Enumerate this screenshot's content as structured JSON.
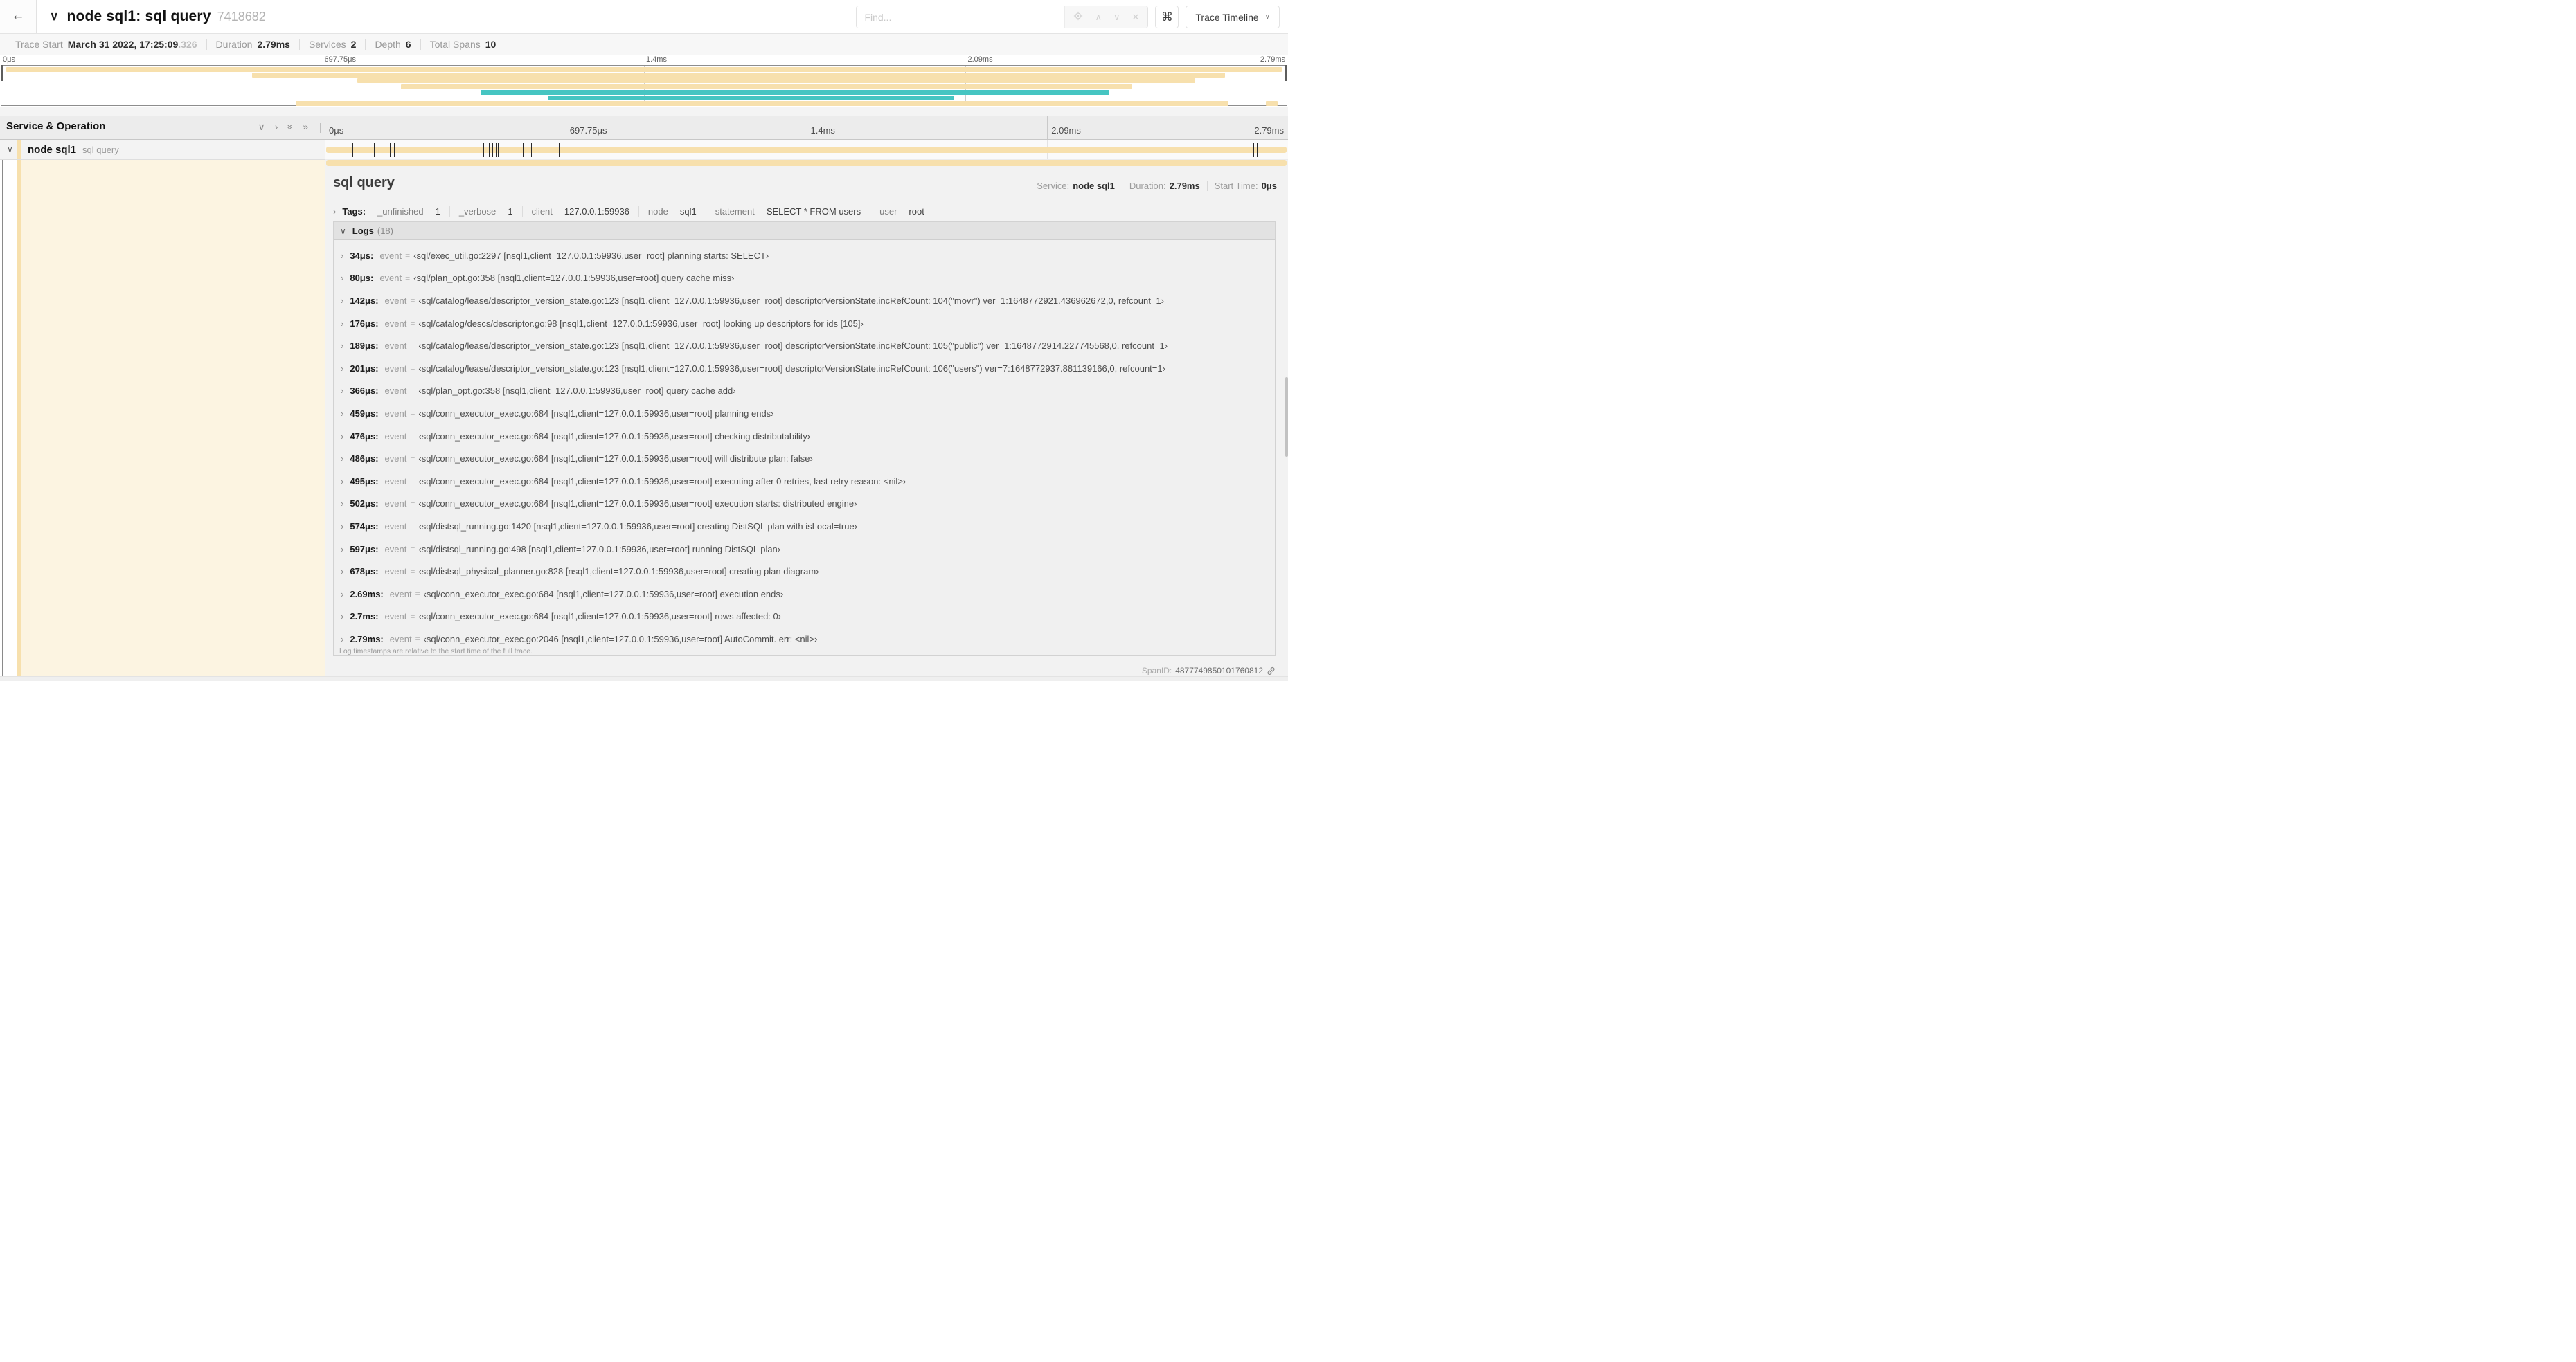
{
  "icons": {
    "back": "←",
    "chevron_down": "∨",
    "chevron_right": "›",
    "double_chevron": "»",
    "up": "∧",
    "close": "✕",
    "command": "⌘"
  },
  "header": {
    "title": "node sql1: sql query",
    "trace_id": "7418682",
    "find_placeholder": "Find...",
    "trace_timeline_label": "Trace Timeline"
  },
  "stats": {
    "items": [
      {
        "label": "Trace Start",
        "value": "March 31 2022, 17:25:09",
        "suffix": ".326"
      },
      {
        "label": "Duration",
        "value": "2.79ms",
        "suffix": ""
      },
      {
        "label": "Services",
        "value": "2",
        "suffix": ""
      },
      {
        "label": "Depth",
        "value": "6",
        "suffix": ""
      },
      {
        "label": "Total Spans",
        "value": "10",
        "suffix": ""
      }
    ]
  },
  "timeline": {
    "header_label": "Service & Operation",
    "ticks": [
      "0μs",
      "697.75μs",
      "1.4ms",
      "2.09ms",
      "2.79ms"
    ],
    "tick_positions": [
      0,
      0.25,
      0.5,
      0.75,
      1
    ],
    "grid_positions": [
      0,
      0.25,
      0.5,
      0.75
    ]
  },
  "minimap": {
    "bars": [
      {
        "row": 0,
        "start": 0.004,
        "end": 0.996,
        "color": "tan"
      },
      {
        "row": 1,
        "start": 0.195,
        "end": 0.952,
        "color": "tan"
      },
      {
        "row": 2,
        "start": 0.277,
        "end": 0.929,
        "color": "tan"
      },
      {
        "row": 3,
        "start": 0.311,
        "end": 0.88,
        "color": "tan"
      },
      {
        "row": 4,
        "start": 0.373,
        "end": 0.862,
        "color": "teal"
      },
      {
        "row": 5,
        "start": 0.425,
        "end": 0.741,
        "color": "teal"
      },
      {
        "row": 6,
        "start": 0.229,
        "end": 0.955,
        "color": "tan"
      },
      {
        "row": 6,
        "start": 0.984,
        "end": 0.993,
        "color": "tan"
      }
    ]
  },
  "span_row": {
    "service": "node sql1",
    "operation": "sql query",
    "log_marks_us": [
      34,
      80,
      142,
      176,
      189,
      201,
      366,
      459,
      476,
      486,
      495,
      502,
      574,
      597,
      678,
      2690,
      2700
    ],
    "trace_duration_us": 2790
  },
  "detail": {
    "title": "sql query",
    "meta": [
      {
        "label": "Service:",
        "value": "node sql1"
      },
      {
        "label": "Duration:",
        "value": "2.79ms"
      },
      {
        "label": "Start Time:",
        "value": "0μs"
      }
    ],
    "tags_label": "Tags:",
    "tags": [
      {
        "key": "_unfinished",
        "value": "1"
      },
      {
        "key": "_verbose",
        "value": "1"
      },
      {
        "key": "client",
        "value": "127.0.0.1:59936"
      },
      {
        "key": "node",
        "value": "sql1"
      },
      {
        "key": "statement",
        "value": "SELECT * FROM users"
      },
      {
        "key": "user",
        "value": "root"
      }
    ],
    "logs_label": "Logs",
    "logs_count": "(18)",
    "event_label": "event",
    "eq": "=",
    "logs": [
      {
        "time": "34μs:",
        "value": "‹sql/exec_util.go:2297 [nsql1,client=127.0.0.1:59936,user=root] planning starts: SELECT›"
      },
      {
        "time": "80μs:",
        "value": "‹sql/plan_opt.go:358 [nsql1,client=127.0.0.1:59936,user=root] query cache miss›"
      },
      {
        "time": "142μs:",
        "value": "‹sql/catalog/lease/descriptor_version_state.go:123 [nsql1,client=127.0.0.1:59936,user=root] descriptorVersionState.incRefCount: 104(\"movr\") ver=1:1648772921.436962672,0, refcount=1›"
      },
      {
        "time": "176μs:",
        "value": "‹sql/catalog/descs/descriptor.go:98 [nsql1,client=127.0.0.1:59936,user=root] looking up descriptors for ids [105]›"
      },
      {
        "time": "189μs:",
        "value": "‹sql/catalog/lease/descriptor_version_state.go:123 [nsql1,client=127.0.0.1:59936,user=root] descriptorVersionState.incRefCount: 105(\"public\") ver=1:1648772914.227745568,0, refcount=1›"
      },
      {
        "time": "201μs:",
        "value": "‹sql/catalog/lease/descriptor_version_state.go:123 [nsql1,client=127.0.0.1:59936,user=root] descriptorVersionState.incRefCount: 106(\"users\") ver=7:1648772937.881139166,0, refcount=1›"
      },
      {
        "time": "366μs:",
        "value": "‹sql/plan_opt.go:358 [nsql1,client=127.0.0.1:59936,user=root] query cache add›"
      },
      {
        "time": "459μs:",
        "value": "‹sql/conn_executor_exec.go:684 [nsql1,client=127.0.0.1:59936,user=root] planning ends›"
      },
      {
        "time": "476μs:",
        "value": "‹sql/conn_executor_exec.go:684 [nsql1,client=127.0.0.1:59936,user=root] checking distributability›"
      },
      {
        "time": "486μs:",
        "value": "‹sql/conn_executor_exec.go:684 [nsql1,client=127.0.0.1:59936,user=root] will distribute plan: false›"
      },
      {
        "time": "495μs:",
        "value": "‹sql/conn_executor_exec.go:684 [nsql1,client=127.0.0.1:59936,user=root] executing after 0 retries, last retry reason: <nil>›"
      },
      {
        "time": "502μs:",
        "value": "‹sql/conn_executor_exec.go:684 [nsql1,client=127.0.0.1:59936,user=root] execution starts: distributed engine›"
      },
      {
        "time": "574μs:",
        "value": "‹sql/distsql_running.go:1420 [nsql1,client=127.0.0.1:59936,user=root] creating DistSQL plan with isLocal=true›"
      },
      {
        "time": "597μs:",
        "value": "‹sql/distsql_running.go:498 [nsql1,client=127.0.0.1:59936,user=root] running DistSQL plan›"
      },
      {
        "time": "678μs:",
        "value": "‹sql/distsql_physical_planner.go:828 [nsql1,client=127.0.0.1:59936,user=root] creating plan diagram›"
      },
      {
        "time": "2.69ms:",
        "value": "‹sql/conn_executor_exec.go:684 [nsql1,client=127.0.0.1:59936,user=root] execution ends›"
      },
      {
        "time": "2.7ms:",
        "value": "‹sql/conn_executor_exec.go:684 [nsql1,client=127.0.0.1:59936,user=root] rows affected: 0›"
      },
      {
        "time": "2.79ms:",
        "value": "‹sql/conn_executor_exec.go:2046 [nsql1,client=127.0.0.1:59936,user=root] AutoCommit. err: <nil>›"
      }
    ],
    "footer_note": "Log timestamps are relative to the start time of the full trace.",
    "span_id_label": "SpanID:",
    "span_id": "4877749850101760812"
  },
  "colors": {
    "tan": "#f7e0ad",
    "teal": "#46c5c2",
    "cream": "#fcf4e1"
  }
}
